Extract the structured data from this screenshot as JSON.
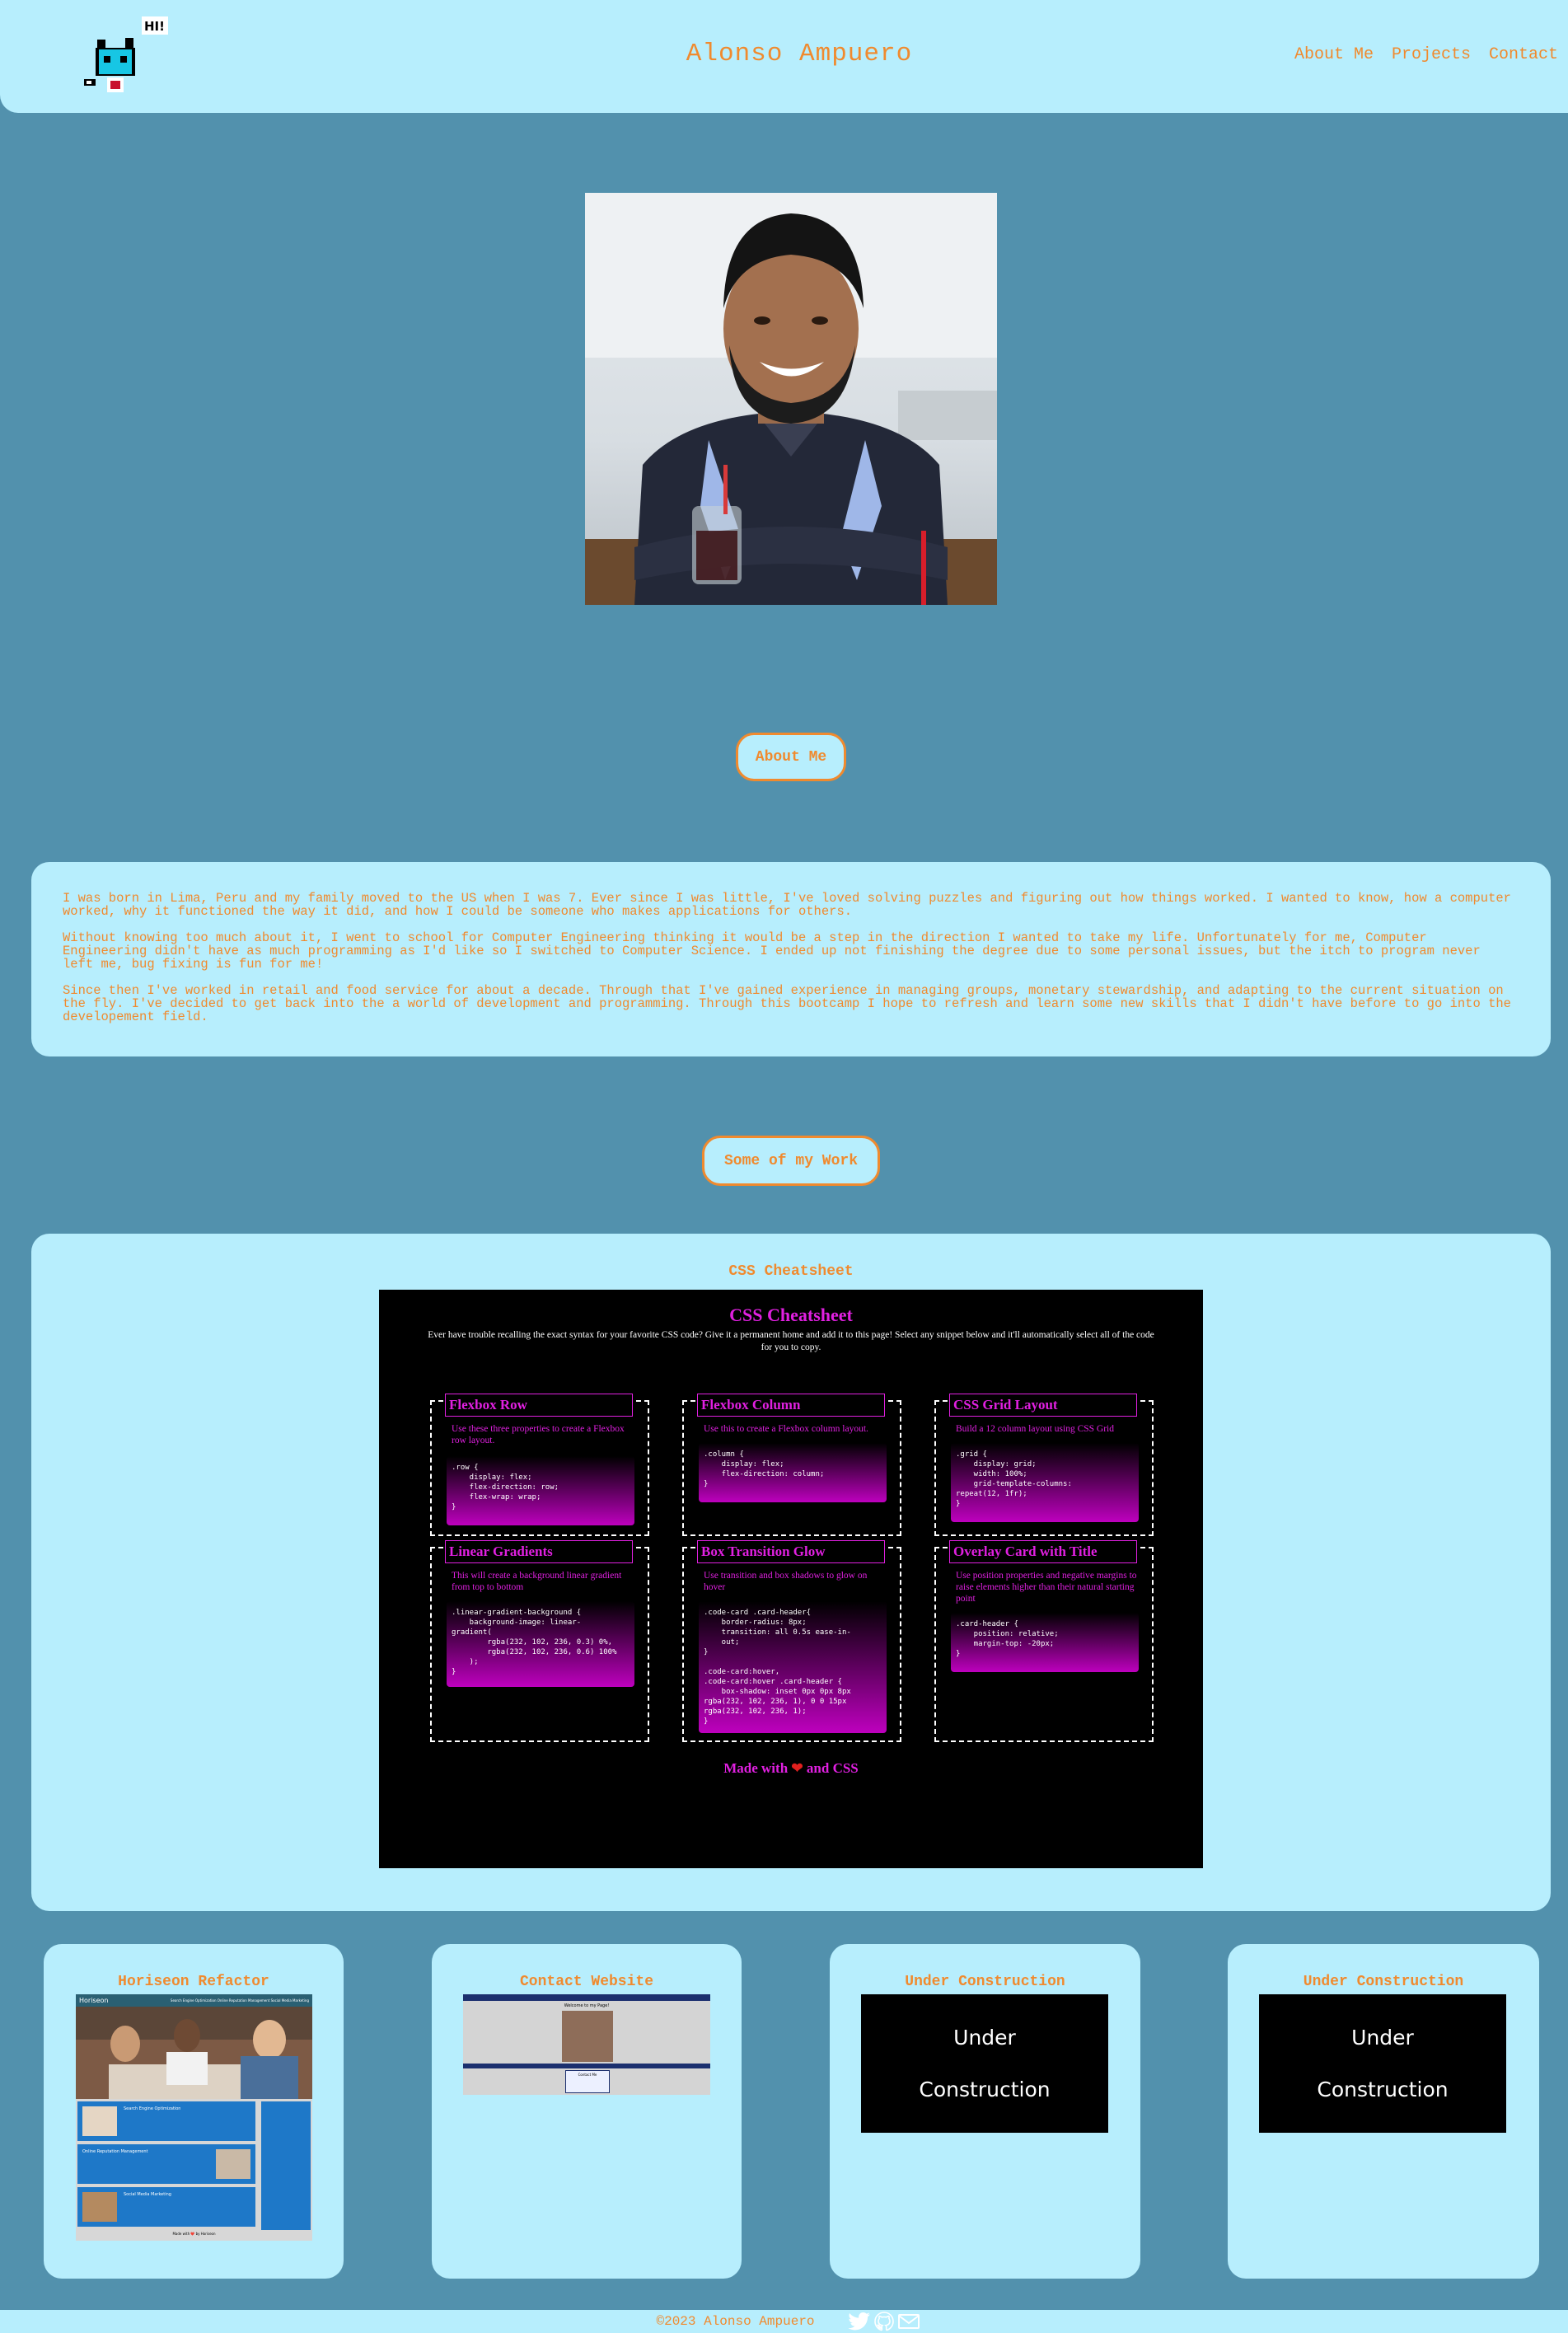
{
  "header": {
    "logo_text": "HI!",
    "title": "Alonso Ampuero",
    "nav": [
      {
        "label": "About Me"
      },
      {
        "label": "Projects"
      },
      {
        "label": "Contact"
      }
    ]
  },
  "about": {
    "heading": "About Me",
    "paragraphs": [
      "I was born in Lima, Peru and my family moved to the US when I was 7. Ever since I was little, I've loved solving puzzles and figuring out how things worked. I wanted to know, how a computer worked, why it functioned the way it did, and how I could be someone who makes applications for others.",
      "Without knowing too much about it, I went to school for Computer Engineering thinking it would be a step in the direction I wanted to take my life. Unfortunately for me, Computer Engineering didn't have as much programming as I'd like so I switched to Computer Science. I ended up not finishing the degree due to some personal issues, but the itch to program never left me, bug fixing is fun for me!",
      "Since then I've worked in retail and food service for about a decade. Through that I've gained experience in managing groups, monetary stewardship, and adapting to the current situation on the fly. I've decided to get back into the a world of development and programming. Through this bootcamp I hope to refresh and learn some new skills that I didn't have before to go into the developement field."
    ]
  },
  "work": {
    "heading": "Some of my Work",
    "featured": {
      "title": "CSS Cheatsheet",
      "cs_title": "CSS Cheatsheet",
      "cs_intro": "Ever have trouble recalling the exact syntax for your favorite CSS code? Give it a permanent home and add it to this page! Select any snippet below and it'll automatically select all of the code for you to copy.",
      "blocks": [
        {
          "title": "Flexbox Row",
          "desc": "Use these three properties to create a Flexbox row layout.",
          "code": ".row {\n    display: flex;\n    flex-direction: row;\n    flex-wrap: wrap;\n}"
        },
        {
          "title": "Flexbox Column",
          "desc": "Use this to create a Flexbox column layout.",
          "code": ".column {\n    display: flex;\n    flex-direction: column;\n}"
        },
        {
          "title": "CSS Grid Layout",
          "desc": "Build a 12 column layout using CSS Grid",
          "code": ".grid {\n    display: grid;\n    width: 100%;\n    grid-template-columns:\nrepeat(12, 1fr);\n}"
        },
        {
          "title": "Linear Gradients",
          "desc": "This will create a background linear gradient from top to bottom",
          "code": ".linear-gradient-background {\n    background-image: linear-\ngradient(\n        rgba(232, 102, 236, 0.3) 0%,\n        rgba(232, 102, 236, 0.6) 100%\n    );\n}"
        },
        {
          "title": "Box Transition Glow",
          "desc": "Use transition and box shadows to glow on hover",
          "code": ".code-card .card-header{\n    border-radius: 8px;\n    transition: all 0.5s ease-in-\n    out;\n}\n\n.code-card:hover,\n.code-card:hover .card-header {\n    box-shadow: inset 0px 0px 8px\nrgba(232, 102, 236, 1), 0 0 15px\nrgba(232, 102, 236, 1);\n}"
        },
        {
          "title": "Overlay Card with Title",
          "desc": "Use position properties and negative margins to raise elements higher than their natural starting point",
          "code": ".card-header {\n    position: relative;\n    margin-top: -20px;\n}"
        }
      ],
      "cs_footer_pre": "Made with",
      "cs_footer_post": "and CSS"
    },
    "projects": [
      {
        "title": "Horiseon Refactor",
        "shot_brand": "Horiseon",
        "shot_nav": "Search Engine Optimization  Online Reputation Management  Social Media Marketing",
        "shot_items": [
          "Search Engine Optimization",
          "Online Reputation Management",
          "Social Media Marketing"
        ],
        "shot_footer": "Made with ❤️ by Horiseon"
      },
      {
        "title": "Contact Website",
        "shot_heading": "Welcome to my Page!",
        "shot_contact": "Contact Me"
      },
      {
        "title": "Under Construction",
        "box_lines": [
          "Under",
          "Construction"
        ]
      },
      {
        "title": "Under Construction",
        "box_lines": [
          "Under",
          "Construction"
        ]
      }
    ]
  },
  "footer": {
    "copyright": "©2023 Alonso Ampuero"
  }
}
